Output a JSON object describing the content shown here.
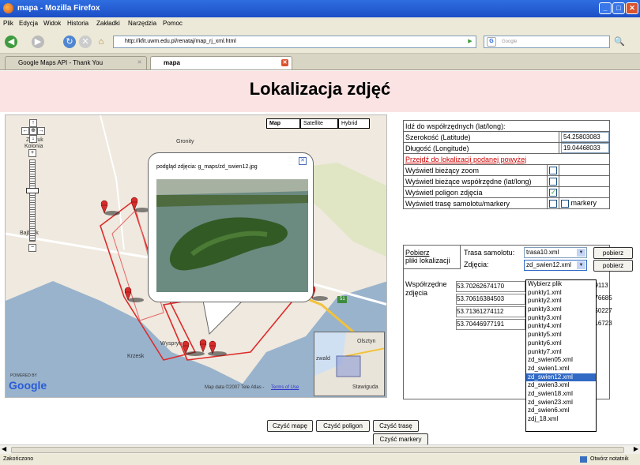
{
  "window": {
    "title": "mapa - Mozilla Firefox"
  },
  "menu": [
    "Plik",
    "Edycja",
    "Widok",
    "Historia",
    "Zakładki",
    "Narzędzia",
    "Pomoc"
  ],
  "nav": {
    "url": "http://kfit.uwm.edu.pl/renataj/map_rj_xml.html",
    "search_placeholder": "Google"
  },
  "tabs": [
    {
      "label": "Google Maps API - Thank You"
    },
    {
      "label": "mapa"
    }
  ],
  "page": {
    "title": "Lokalizacja zdjęć"
  },
  "map": {
    "types": [
      "Map",
      "Satellite",
      "Hybrid"
    ],
    "popup_label": "podgląd zdjęcia: g_maps/zd_swien12.jpg",
    "attribution": "Map data ©2007 Tele Atlas -",
    "terms": "Terms of Use",
    "labels": {
      "zegruk": "Zagruk",
      "kolonia": "Kolonia",
      "gronity": "Gronity",
      "bajbruk": "Bajbruk",
      "krzesk": "Krzesk",
      "wysprynt": "Wyspryn",
      "olsztyn": "Olsztyn",
      "stawiguda": "Stawiguda",
      "zwald": "zwald",
      "road": "51"
    },
    "powered_by": "POWERED BY",
    "logo": "Google"
  },
  "form": {
    "goto_header": "Idź do współrzędnych (lat/long):",
    "lat_label": "Szerokość (Latitude)",
    "lat_value": "54.25803083",
    "lng_label": "Długość (Longitude)",
    "lng_value": "19.04468033",
    "goto_link": "Przejdź do lokalizacji podanej powyżej",
    "show_zoom": "Wyświetl bieżący zoom",
    "show_coords": "Wyświetl bieżące współrzędne (lat/long)",
    "show_polygon": "Wyświetl poligon zdjęcia",
    "show_route": "Wyświetl trasę samolotu/markery",
    "markery": "markery"
  },
  "files": {
    "label_line1": "Pobierz",
    "label_line2": "pliki lokalizacji",
    "route_label": "Trasa samolotu:",
    "route_value": "trasa10.xml",
    "photos_label": "Zdjęcia:",
    "photos_value": "zd_swien12.xml",
    "download": "pobierz",
    "coords_label_1": "Współrzędne",
    "coords_label_2": "zdjęcia",
    "coords": [
      "53.70262674170",
      "53.70616384503",
      "53.71361274112",
      "53.70446977191"
    ],
    "coords_tail": [
      "29113",
      "676685",
      "050227",
      "516723"
    ]
  },
  "dropdown": {
    "options": [
      "Wybierz plik",
      "punkty1.xml",
      "punkty2.xml",
      "punkty3.xml",
      "punkty3.xml",
      "punkty4.xml",
      "punkty5.xml",
      "punkty6.xml",
      "punkty7.xml",
      "zd_swien05.xml",
      "zd_swien1.xml",
      "zd_swien12.xml",
      "zd_swien3.xml",
      "zd_swien18.xml",
      "zd_swien23.xml",
      "zd_swien6.xml",
      "zdj_18.xml"
    ],
    "selected": "zd_swien12.xml"
  },
  "buttons": {
    "clear_map": "Czyść mapę",
    "clear_polygon": "Czyść poligon",
    "clear_route": "Czyść trasę",
    "clear_markers": "Czyść markery"
  },
  "status": {
    "left": "Zakończono",
    "right": "Otwórz notatnik"
  }
}
